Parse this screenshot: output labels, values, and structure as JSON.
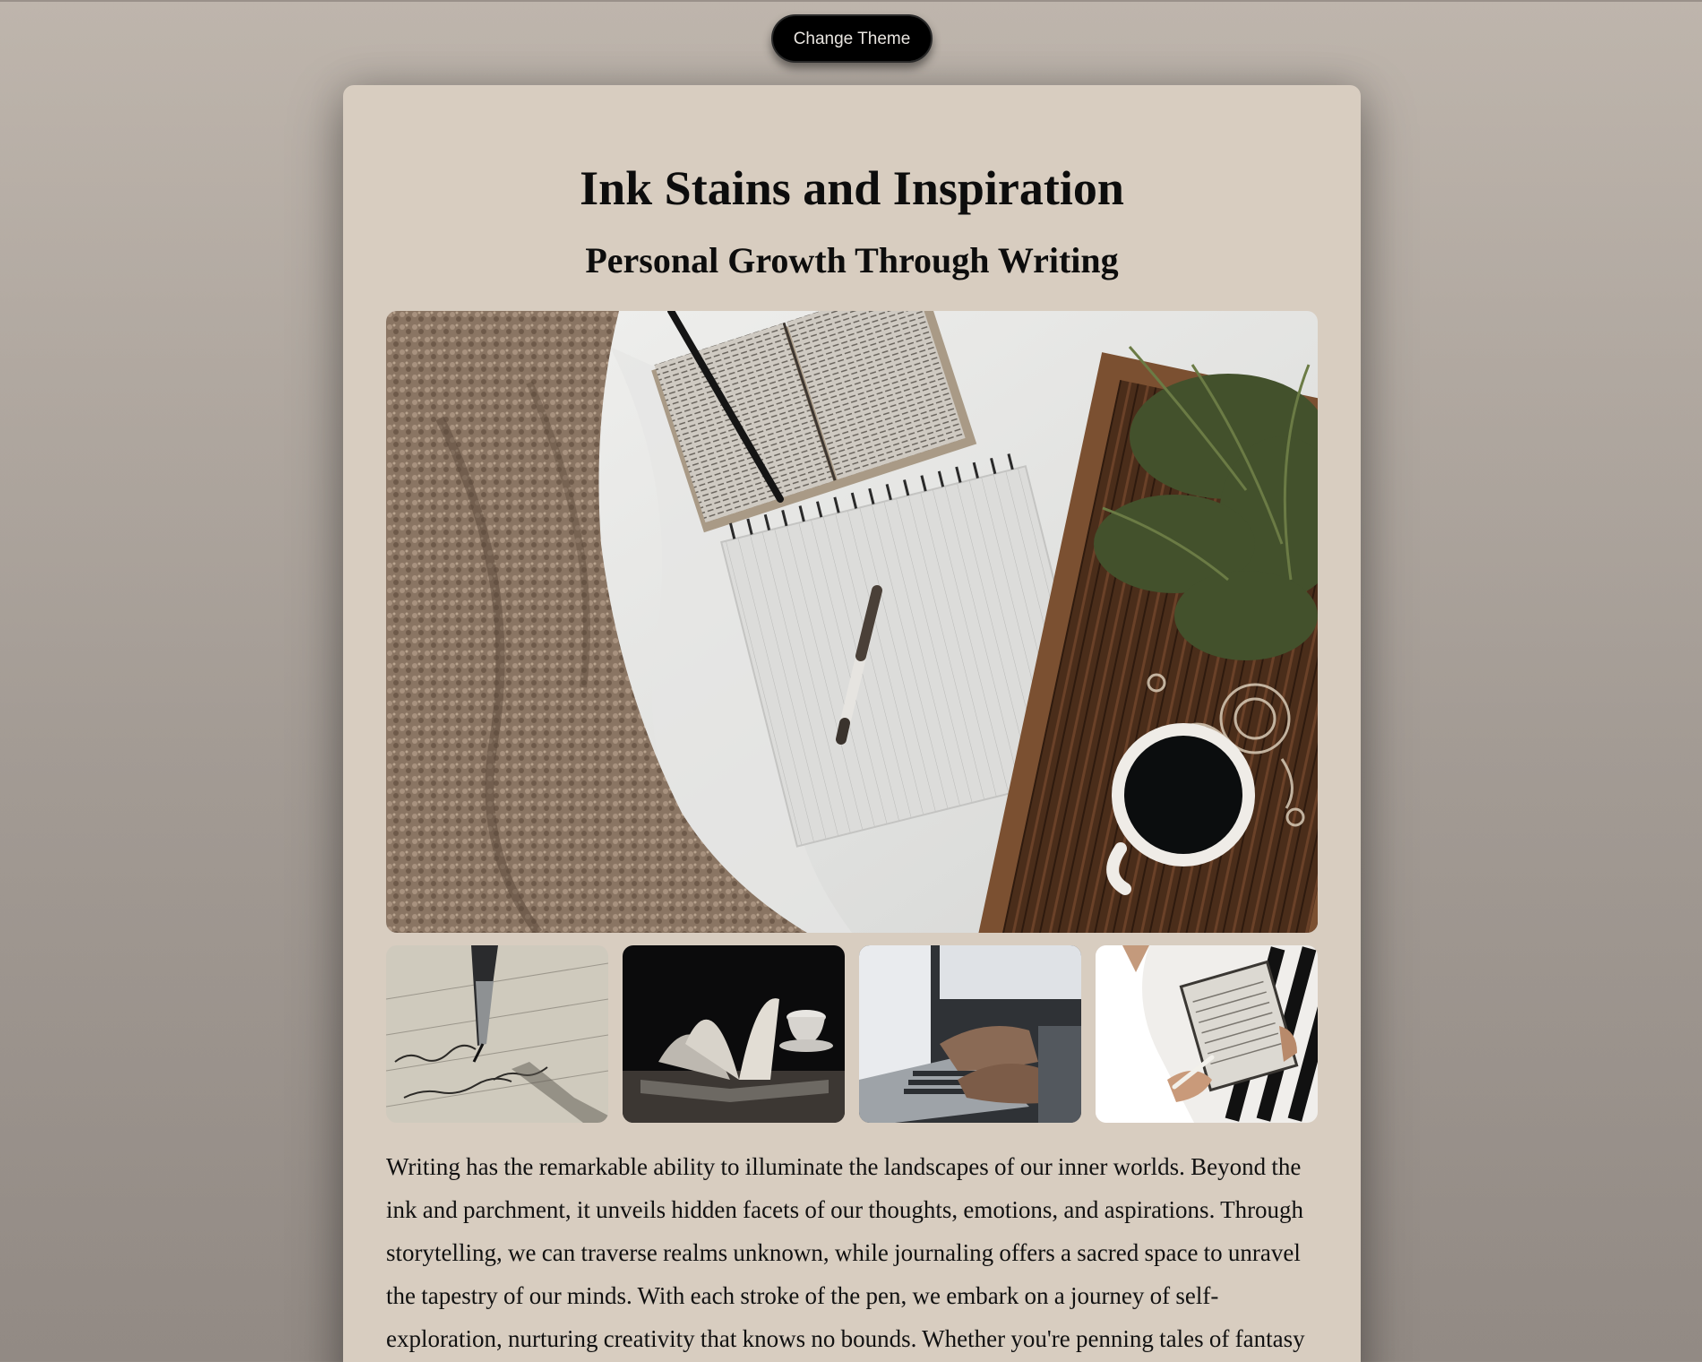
{
  "toolbar": {
    "theme_button_label": "Change Theme"
  },
  "article": {
    "title": "Ink Stains and Inspiration",
    "subtitle": "Personal Growth Through Writing",
    "body": "Writing has the remarkable ability to illuminate the landscapes of our inner worlds. Beyond the ink and parchment, it unveils hidden facets of our thoughts, emotions, and aspirations. Through storytelling, we can traverse realms unknown, while journaling offers a sacred space to unravel the tapestry of our minds. With each stroke of the pen, we embark on a journey of self-exploration, nurturing creativity that knows no bounds. Whether you're penning tales of fantasy"
  },
  "colors": {
    "background": "#b3aaa2",
    "card": "#d8cdc0",
    "button": "#000000",
    "text": "#0d0d0d"
  }
}
